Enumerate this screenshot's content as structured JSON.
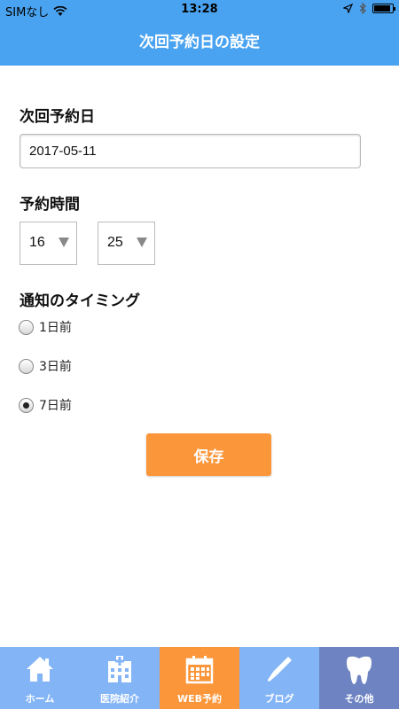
{
  "status_bar": {
    "carrier": "SIMなし",
    "time": "13:28",
    "battery_level": 0.9
  },
  "header": {
    "title": "次回予約日の設定"
  },
  "form": {
    "date_label": "次回予約日",
    "date_value": "2017-05-11",
    "time_label": "予約時間",
    "hour_value": "16",
    "minute_value": "25",
    "timing_label": "通知のタイミング",
    "timing_options": [
      {
        "label": "1日前",
        "checked": false
      },
      {
        "label": "3日前",
        "checked": false
      },
      {
        "label": "7日前",
        "checked": true
      }
    ],
    "save_label": "保存"
  },
  "tabbar": {
    "items": [
      {
        "label": "ホーム",
        "icon": "home-icon"
      },
      {
        "label": "医院紹介",
        "icon": "hospital-icon"
      },
      {
        "label": "WEB予約",
        "icon": "calendar-icon",
        "active": true
      },
      {
        "label": "ブログ",
        "icon": "pen-icon"
      },
      {
        "label": "その他",
        "icon": "tooth-icon"
      }
    ]
  },
  "colors": {
    "primary": "#4aa3f0",
    "accent": "#fb963b",
    "tab_bg": "#83b4f6",
    "tab_last": "#6e84c2"
  }
}
